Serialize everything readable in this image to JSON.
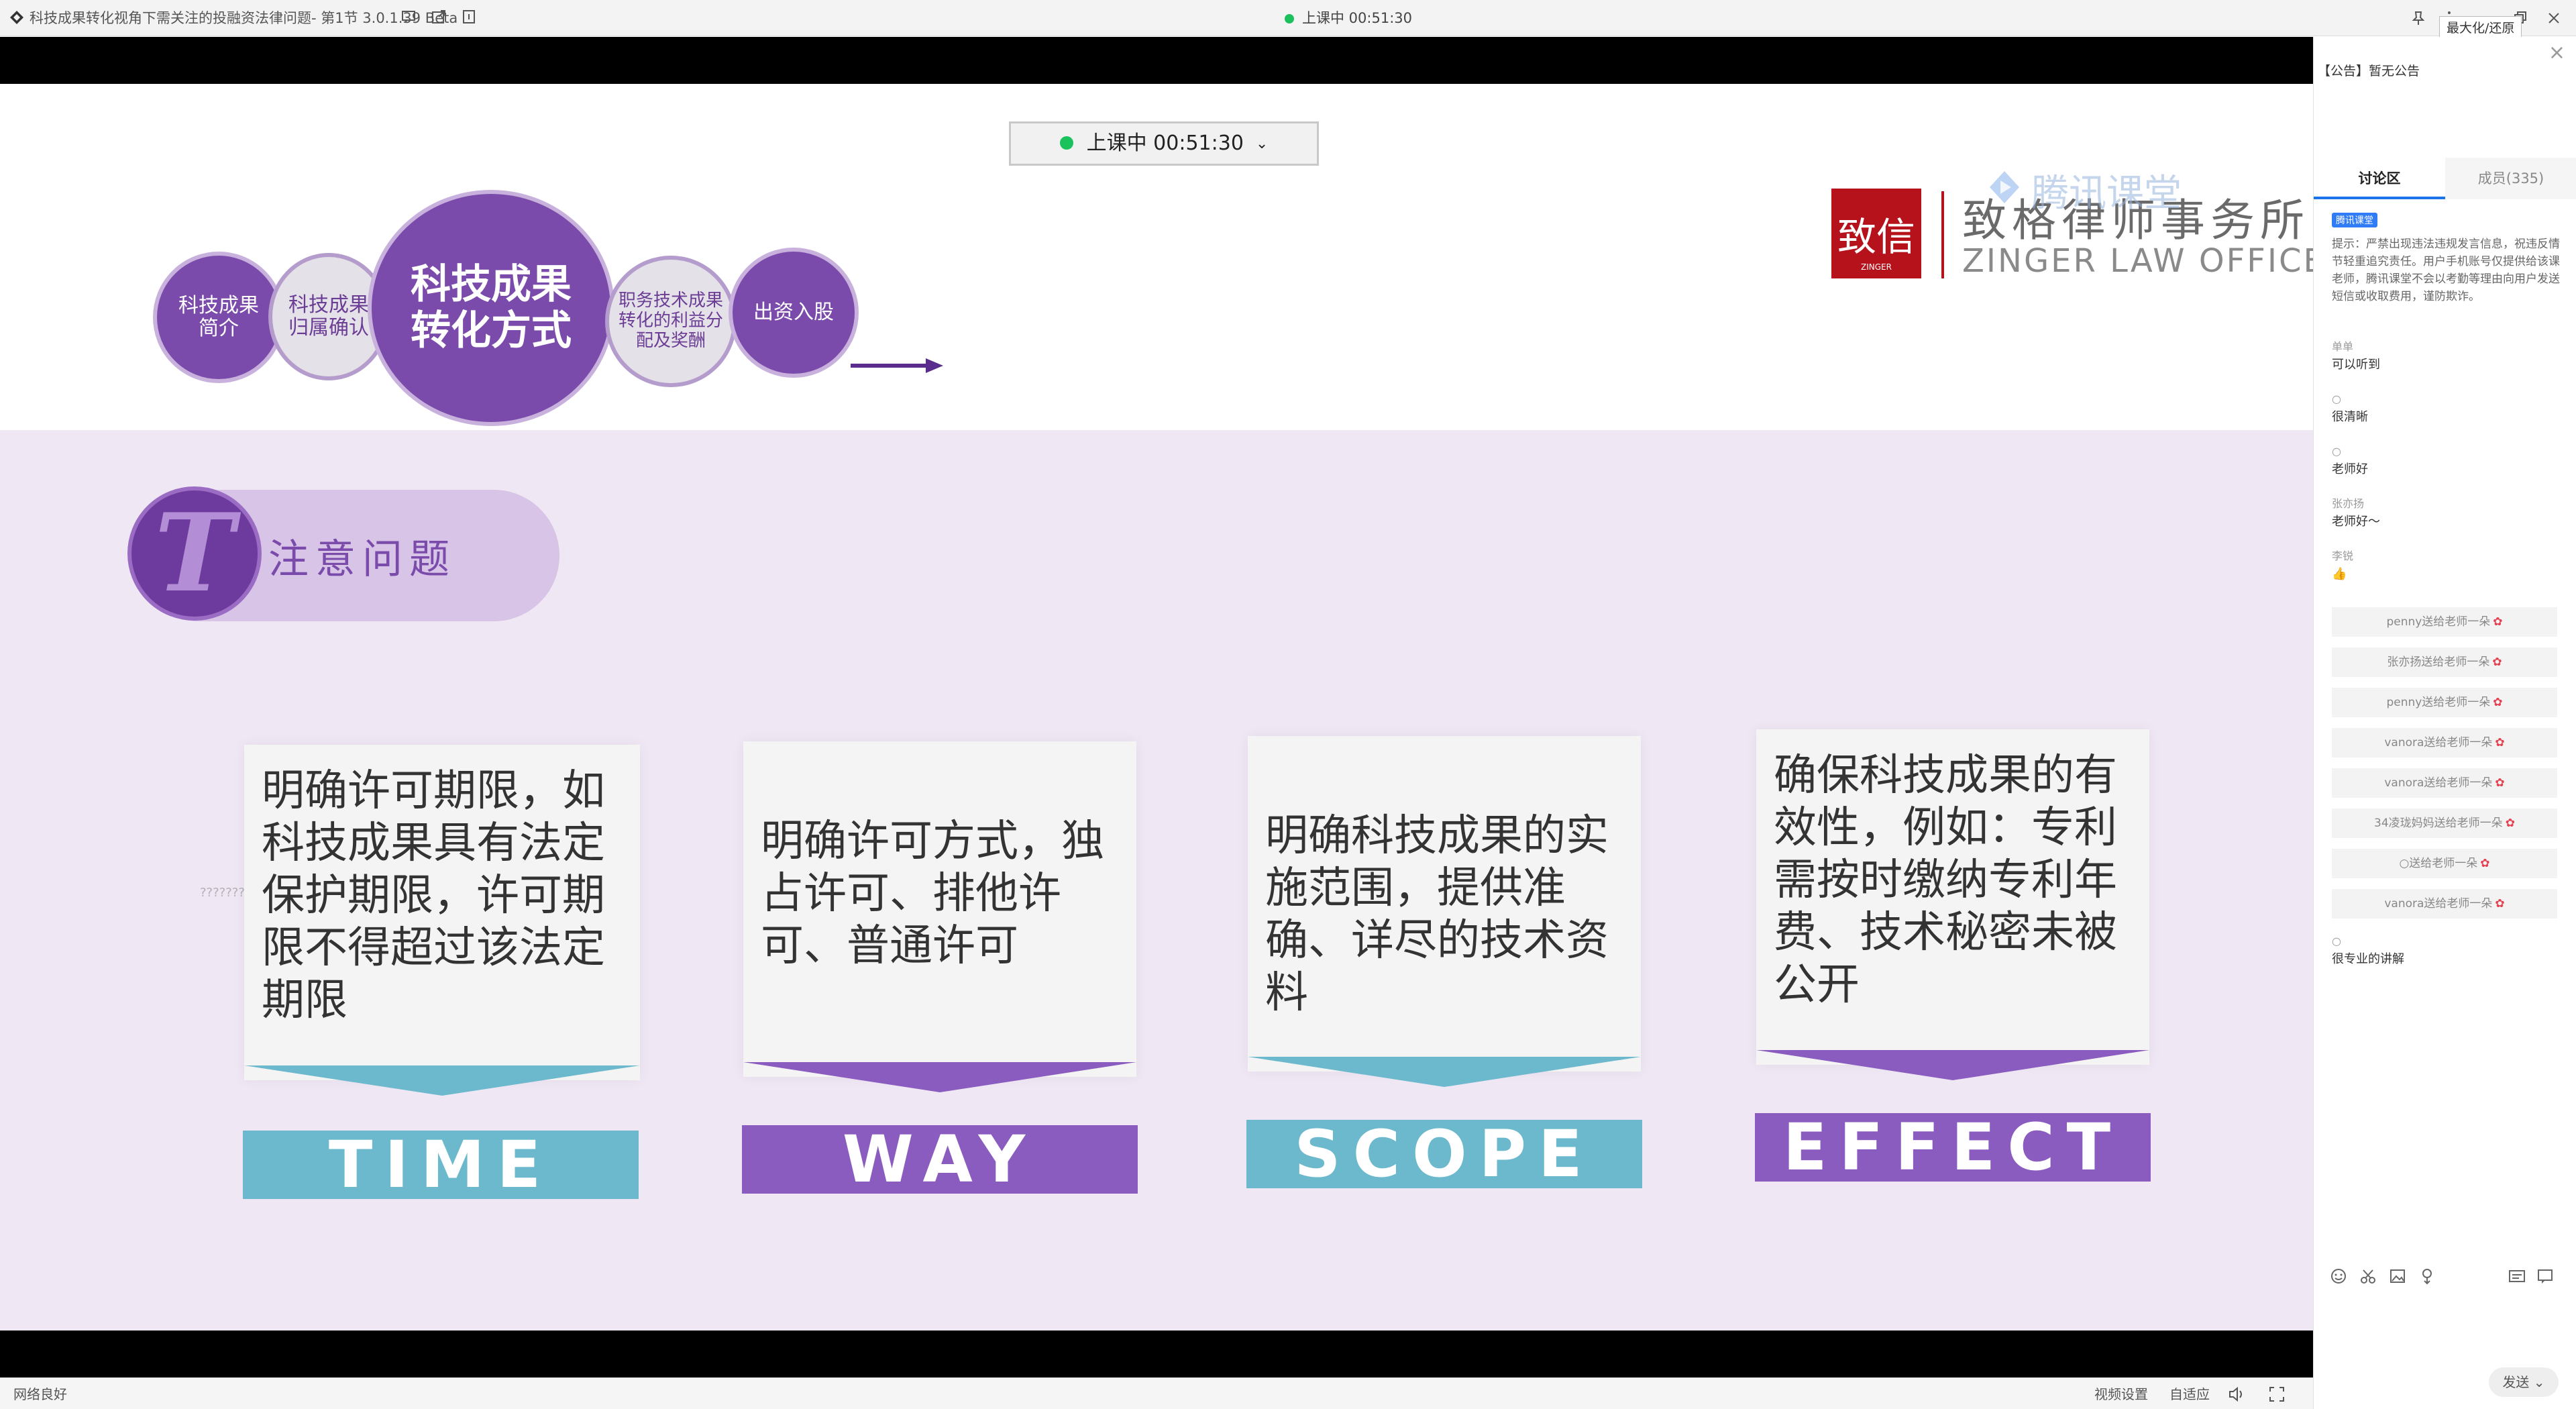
{
  "titlebar": {
    "title": "科技成果转化视角下需关注的投融资法律问题- 第1节 3.0.1.39 Beta",
    "center_status": "上课中 00:51:30",
    "tooltip": "最大化/还原"
  },
  "slide": {
    "live_status": "上课中 00:51:30",
    "circles": [
      {
        "label": "科技成果\n简介",
        "style": "purple"
      },
      {
        "label": "科技成果\n归属确认",
        "style": "grey"
      },
      {
        "label": "科技成果\n转化方式",
        "style": "purple"
      },
      {
        "label": "职务技术成果\n转化的利益分\n配及奖酬",
        "style": "grey"
      },
      {
        "label": "出资入股",
        "style": "purple"
      }
    ],
    "logo": {
      "seal_text": "致信",
      "seal_sub": "ZINGER",
      "name_cn": "致格律师事务所",
      "name_en": "ZINGER LAW OFFICE"
    },
    "watermark": "腾讯课堂",
    "section": {
      "letter": "T",
      "title": "注意问题"
    },
    "cards": [
      {
        "text": "明确许可期限，如科技成果具有法定保护期限，许可期限不得超过该法定期限",
        "label": "TIME",
        "color": "#6cb9cd"
      },
      {
        "text": "明确许可方式，独占许可、排他许可、普通许可",
        "label": "WAY",
        "color": "#8b5cc0"
      },
      {
        "text": "明确科技成果的实施范围，提供准确、详尽的技术资料",
        "label": "SCOPE",
        "color": "#6cb9cd"
      },
      {
        "text": "确保科技成果的有效性，例如：专利需按时缴纳专利年费、技术秘密未被公开",
        "label": "EFFECT",
        "color": "#8b5cc0"
      }
    ],
    "small_watermark": "??????????????????"
  },
  "statusbar": {
    "network": "网络良好",
    "video_settings": "视频设置",
    "adapt": "自适应"
  },
  "panel": {
    "notice": "【公告】暂无公告",
    "tabs": [
      "讨论区",
      "成员(335)"
    ],
    "badge": "腾讯课堂",
    "tip": "提示：严禁出现违法违规发言信息，祝违反情节轻重追究责任。用户手机账号仅提供给该课老师，腾讯课堂不会以考勤等理由向用户发送短信或收取费用，谨防欺诈。",
    "messages": [
      {
        "name": "单单",
        "text": "可以听到"
      },
      {
        "name": "○",
        "text": "很清晰"
      },
      {
        "name": "○",
        "text": "老师好"
      },
      {
        "name": "张亦扬",
        "text": "老师好～"
      },
      {
        "name": "李锐",
        "text": "👍"
      }
    ],
    "gifts": [
      "penny送给老师一朵",
      "张亦扬送给老师一朵",
      "penny送给老师一朵",
      "vanora送给老师一朵",
      "vanora送给老师一朵",
      "34凌珑妈妈送给老师一朵",
      "○送给老师一朵",
      "vanora送给老师一朵"
    ],
    "last_message": {
      "name": "○",
      "text": "很专业的讲解"
    },
    "send_label": "发送"
  }
}
